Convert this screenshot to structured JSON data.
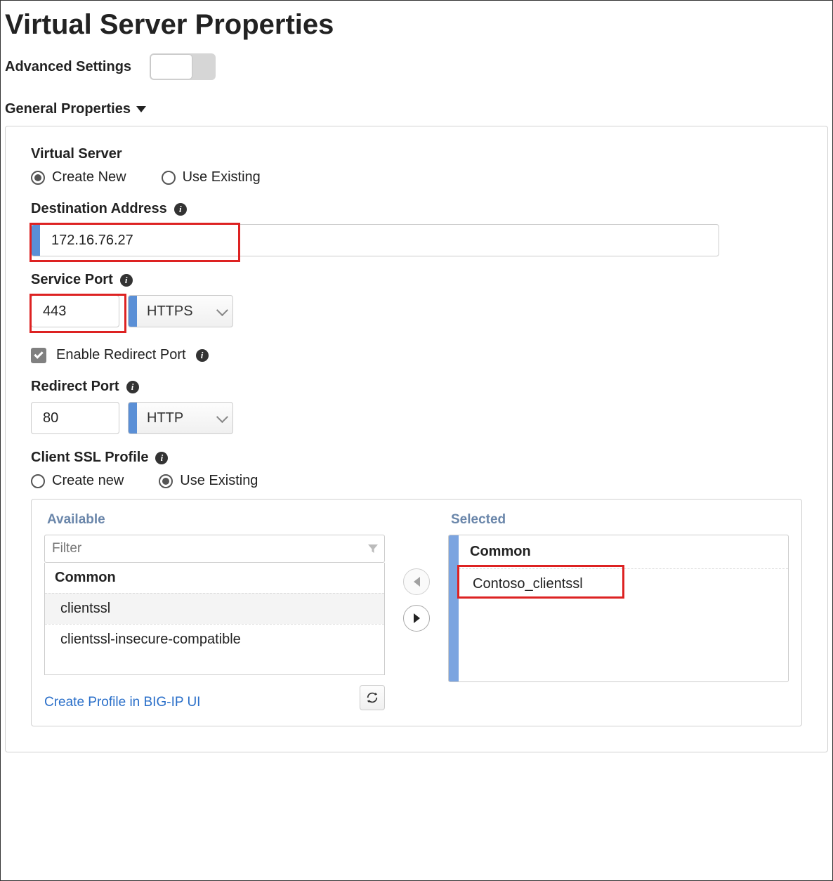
{
  "title": "Virtual Server Properties",
  "advanced": {
    "label": "Advanced Settings",
    "on": false
  },
  "section": {
    "title": "General Properties"
  },
  "vs": {
    "label": "Virtual Server",
    "opt_create": "Create New",
    "opt_existing": "Use Existing",
    "selected": "create"
  },
  "dest": {
    "label": "Destination Address",
    "value": "172.16.76.27"
  },
  "port": {
    "label": "Service Port",
    "value": "443",
    "protocol": "HTTPS"
  },
  "redirect_enable": {
    "label": "Enable Redirect Port",
    "checked": true
  },
  "redirect": {
    "label": "Redirect Port",
    "value": "80",
    "protocol": "HTTP"
  },
  "ssl": {
    "label": "Client SSL Profile",
    "opt_create": "Create new",
    "opt_existing": "Use Existing",
    "selected": "existing"
  },
  "dual": {
    "available_title": "Available",
    "selected_title": "Selected",
    "filter_placeholder": "Filter",
    "group": "Common",
    "available": [
      "clientssl",
      "clientssl-insecure-compatible"
    ],
    "selected_group": "Common",
    "selected_item": "Contoso_clientssl",
    "create_link": "Create Profile in BIG-IP UI"
  }
}
